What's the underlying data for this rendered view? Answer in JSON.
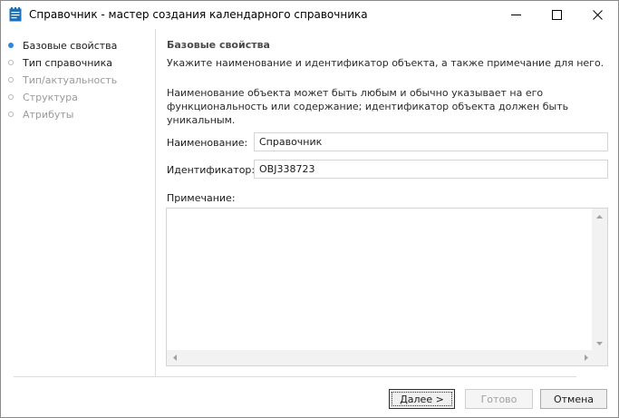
{
  "window": {
    "title": "Справочник - мастер создания календарного справочника"
  },
  "icons": {
    "app": "calendar-directory-icon",
    "minimize": "minimize-icon",
    "maximize": "maximize-icon",
    "close": "close-icon"
  },
  "colors": {
    "active_step": "#2e86de",
    "disabled_text": "#9a9a9a",
    "app_icon": "#1f6fb5"
  },
  "nav": {
    "items": [
      {
        "label": "Базовые свойства",
        "state": "active"
      },
      {
        "label": "Тип справочника",
        "state": "normal"
      },
      {
        "label": "Тип/актуальность",
        "state": "disabled"
      },
      {
        "label": "Структура",
        "state": "disabled"
      },
      {
        "label": "Атрибуты",
        "state": "disabled"
      }
    ]
  },
  "page": {
    "title": "Базовые свойства",
    "subtitle": "Укажите наименование и идентификатор объекта, а также примечание для него.",
    "description": "Наименование объекта может быть любым и обычно указывает на его функциональность или содержание; идентификатор объекта должен быть уникальным."
  },
  "form": {
    "name_label": "Наименование:",
    "name_value": "Справочник",
    "id_label": "Идентификатор:",
    "id_value": "OBJ338723",
    "note_label": "Примечание:",
    "note_value": ""
  },
  "buttons": {
    "next": "Далее >",
    "done": "Готово",
    "cancel": "Отмена"
  }
}
